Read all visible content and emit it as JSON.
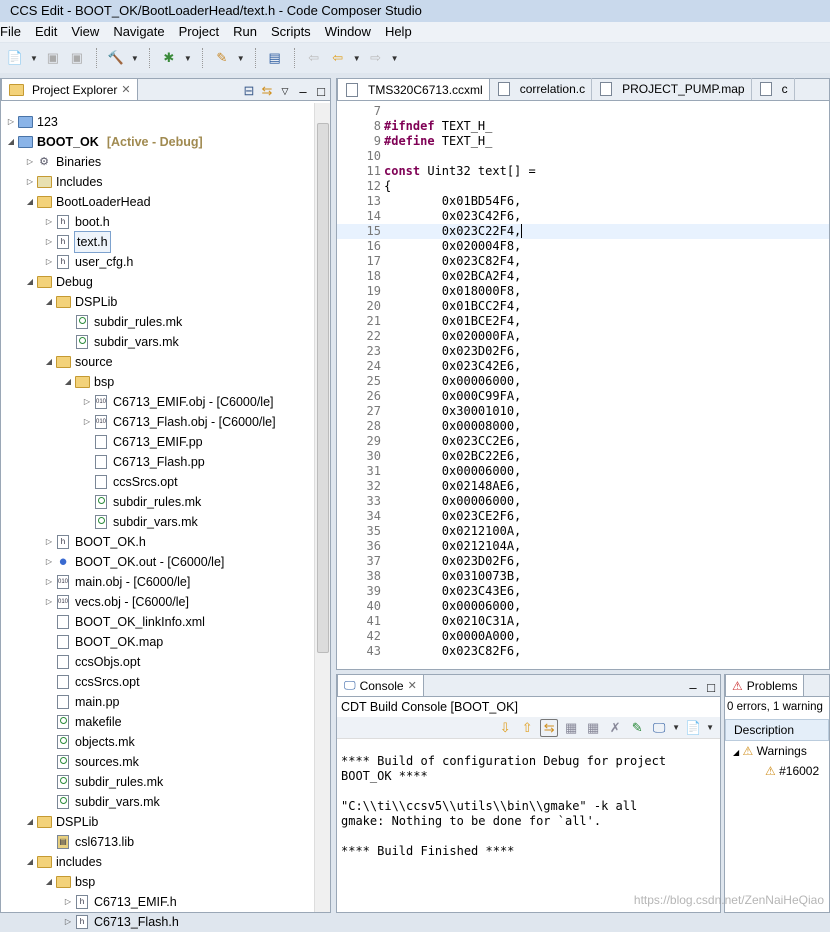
{
  "window": {
    "title": "CCS Edit - BOOT_OK/BootLoaderHead/text.h - Code Composer Studio"
  },
  "menu": [
    "File",
    "Edit",
    "View",
    "Navigate",
    "Project",
    "Run",
    "Scripts",
    "Window",
    "Help"
  ],
  "explorer": {
    "title": "Project Explorer",
    "items": [
      {
        "label": "123",
        "level": 0,
        "arrow": "collapsed",
        "icon": "ccs-project"
      },
      {
        "label": "BOOT_OK",
        "suffix": "[Active - Debug]",
        "level": 0,
        "arrow": "expanded",
        "icon": "ccs-project-warning",
        "bold": true
      },
      {
        "label": "Binaries",
        "level": 1,
        "arrow": "collapsed",
        "icon": "binaries"
      },
      {
        "label": "Includes",
        "level": 1,
        "arrow": "collapsed",
        "icon": "includes"
      },
      {
        "label": "BootLoaderHead",
        "level": 1,
        "arrow": "expanded",
        "icon": "folder"
      },
      {
        "label": "boot.h",
        "level": 2,
        "arrow": "collapsed",
        "icon": "h-file"
      },
      {
        "label": "text.h",
        "level": 2,
        "arrow": "collapsed",
        "icon": "h-file",
        "selected": true
      },
      {
        "label": "user_cfg.h",
        "level": 2,
        "arrow": "collapsed",
        "icon": "h-file"
      },
      {
        "label": "Debug",
        "level": 1,
        "arrow": "expanded",
        "icon": "folder"
      },
      {
        "label": "DSPLib",
        "level": 2,
        "arrow": "expanded",
        "icon": "folder"
      },
      {
        "label": "subdir_rules.mk",
        "level": 3,
        "arrow": "none",
        "icon": "mk-file"
      },
      {
        "label": "subdir_vars.mk",
        "level": 3,
        "arrow": "none",
        "icon": "mk-file"
      },
      {
        "label": "source",
        "level": 2,
        "arrow": "expanded",
        "icon": "folder"
      },
      {
        "label": "bsp",
        "level": 3,
        "arrow": "expanded",
        "icon": "folder"
      },
      {
        "label": "C6713_EMIF.obj - [C6000/le]",
        "level": 4,
        "arrow": "collapsed",
        "icon": "obj-file"
      },
      {
        "label": "C6713_Flash.obj - [C6000/le]",
        "level": 4,
        "arrow": "collapsed",
        "icon": "obj-file"
      },
      {
        "label": "C6713_EMIF.pp",
        "level": 4,
        "arrow": "none",
        "icon": "file"
      },
      {
        "label": "C6713_Flash.pp",
        "level": 4,
        "arrow": "none",
        "icon": "file"
      },
      {
        "label": "ccsSrcs.opt",
        "level": 4,
        "arrow": "none",
        "icon": "file"
      },
      {
        "label": "subdir_rules.mk",
        "level": 4,
        "arrow": "none",
        "icon": "mk-file"
      },
      {
        "label": "subdir_vars.mk",
        "level": 4,
        "arrow": "none",
        "icon": "mk-file"
      },
      {
        "label": "BOOT_OK.h",
        "level": 2,
        "arrow": "collapsed",
        "icon": "h-file"
      },
      {
        "label": "BOOT_OK.out - [C6000/le]",
        "level": 2,
        "arrow": "collapsed",
        "icon": "out-file"
      },
      {
        "label": "main.obj - [C6000/le]",
        "level": 2,
        "arrow": "collapsed",
        "icon": "obj-file"
      },
      {
        "label": "vecs.obj - [C6000/le]",
        "level": 2,
        "arrow": "collapsed",
        "icon": "obj-file"
      },
      {
        "label": "BOOT_OK_linkInfo.xml",
        "level": 2,
        "arrow": "none",
        "icon": "file"
      },
      {
        "label": "BOOT_OK.map",
        "level": 2,
        "arrow": "none",
        "icon": "file"
      },
      {
        "label": "ccsObjs.opt",
        "level": 2,
        "arrow": "none",
        "icon": "file"
      },
      {
        "label": "ccsSrcs.opt",
        "level": 2,
        "arrow": "none",
        "icon": "file"
      },
      {
        "label": "main.pp",
        "level": 2,
        "arrow": "none",
        "icon": "file"
      },
      {
        "label": "makefile",
        "level": 2,
        "arrow": "none",
        "icon": "mk-file"
      },
      {
        "label": "objects.mk",
        "level": 2,
        "arrow": "none",
        "icon": "mk-file"
      },
      {
        "label": "sources.mk",
        "level": 2,
        "arrow": "none",
        "icon": "mk-file"
      },
      {
        "label": "subdir_rules.mk",
        "level": 2,
        "arrow": "none",
        "icon": "mk-file"
      },
      {
        "label": "subdir_vars.mk",
        "level": 2,
        "arrow": "none",
        "icon": "mk-file"
      },
      {
        "label": "DSPLib",
        "level": 1,
        "arrow": "expanded",
        "icon": "folder"
      },
      {
        "label": "csl6713.lib",
        "level": 2,
        "arrow": "none",
        "icon": "lib-file"
      },
      {
        "label": "includes",
        "level": 1,
        "arrow": "expanded",
        "icon": "folder"
      },
      {
        "label": "bsp",
        "level": 2,
        "arrow": "expanded",
        "icon": "folder"
      },
      {
        "label": "C6713_EMIF.h",
        "level": 3,
        "arrow": "collapsed",
        "icon": "h-file"
      },
      {
        "label": "C6713_Flash.h",
        "level": 3,
        "arrow": "collapsed",
        "icon": "h-file"
      }
    ]
  },
  "editor": {
    "tabs": [
      "TMS320C6713.ccxml",
      "correlation.c",
      "PROJECT_PUMP.map",
      "c"
    ],
    "current_line": 15,
    "lines": [
      {
        "n": "7",
        "t": ""
      },
      {
        "n": "8",
        "kw": "#ifndef",
        "t": " TEXT_H_"
      },
      {
        "n": "9",
        "kw": "#define",
        "t": " TEXT_H_"
      },
      {
        "n": "10",
        "t": ""
      },
      {
        "n": "11",
        "kw": "const",
        "t": " Uint32 text[] ="
      },
      {
        "n": "12",
        "t": "{"
      },
      {
        "n": "13",
        "t": "        0x01BD54F6,"
      },
      {
        "n": "14",
        "t": "        0x023C42F6,"
      },
      {
        "n": "15",
        "t": "        0x023C22F4,"
      },
      {
        "n": "16",
        "t": "        0x020004F8,"
      },
      {
        "n": "17",
        "t": "        0x023C82F4,"
      },
      {
        "n": "18",
        "t": "        0x02BCA2F4,"
      },
      {
        "n": "19",
        "t": "        0x018000F8,"
      },
      {
        "n": "20",
        "t": "        0x01BCC2F4,"
      },
      {
        "n": "21",
        "t": "        0x01BCE2F4,"
      },
      {
        "n": "22",
        "t": "        0x020000FA,"
      },
      {
        "n": "23",
        "t": "        0x023D02F6,"
      },
      {
        "n": "24",
        "t": "        0x023C42E6,"
      },
      {
        "n": "25",
        "t": "        0x00006000,"
      },
      {
        "n": "26",
        "t": "        0x000C99FA,"
      },
      {
        "n": "27",
        "t": "        0x30001010,"
      },
      {
        "n": "28",
        "t": "        0x00008000,"
      },
      {
        "n": "29",
        "t": "        0x023CC2E6,"
      },
      {
        "n": "30",
        "t": "        0x02BC22E6,"
      },
      {
        "n": "31",
        "t": "        0x00006000,"
      },
      {
        "n": "32",
        "t": "        0x02148AE6,"
      },
      {
        "n": "33",
        "t": "        0x00006000,"
      },
      {
        "n": "34",
        "t": "        0x023CE2F6,"
      },
      {
        "n": "35",
        "t": "        0x0212100A,"
      },
      {
        "n": "36",
        "t": "        0x0212104A,"
      },
      {
        "n": "37",
        "t": "        0x023D02F6,"
      },
      {
        "n": "38",
        "t": "        0x0310073B,"
      },
      {
        "n": "39",
        "t": "        0x023C43E6,"
      },
      {
        "n": "40",
        "t": "        0x00006000,"
      },
      {
        "n": "41",
        "t": "        0x0210C31A,"
      },
      {
        "n": "42",
        "t": "        0x0000A000,"
      },
      {
        "n": "43",
        "t": "        0x023C82F6,"
      }
    ]
  },
  "console": {
    "title": "Console",
    "subtitle": "CDT Build Console [BOOT_OK]",
    "output": "\n**** Build of configuration Debug for project\nBOOT_OK ****\n\n\"C:\\\\ti\\\\ccsv5\\\\utils\\\\bin\\\\gmake\" -k all\ngmake: Nothing to be done for `all'.\n\n**** Build Finished ****"
  },
  "problems": {
    "title": "Problems",
    "summary": "0 errors, 1 warning",
    "column": "Description",
    "group": "Warnings",
    "item": "#16002"
  },
  "watermark": "https://blog.csdn.net/ZenNaiHeQiao"
}
